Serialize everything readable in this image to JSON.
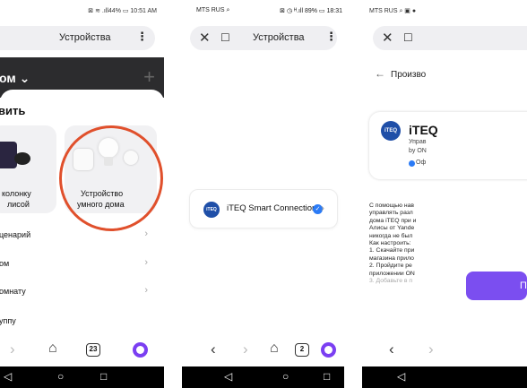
{
  "panel1": {
    "status_right": "⊠ ≋ .ıll44% ▭ 10:51 AM",
    "title": "Устройства",
    "menu": "⋮",
    "home": "ом ⌄",
    "plus": "+",
    "sheet_title": "вить",
    "card_left_line1": "колонку",
    "card_left_line2": "лисой",
    "card_right_line1": "Устройство",
    "card_right_line2": "умного дома",
    "rows": [
      "ценарий",
      "ом",
      "омнату",
      "уппу"
    ],
    "tabs": "23",
    "accent": "#e0502c"
  },
  "panel2": {
    "status_left": "MTS RUS ⌕",
    "status_right": "⊠ ◷ ᴴ.ıll 89% ▭ 18:31",
    "close": "✕",
    "bookmark": "☐",
    "title": "Устройства",
    "menu": "⋮",
    "item_name": "iTEQ Smart Connection",
    "logo_text": "iTEQ",
    "verified": "✓",
    "tabs": "2"
  },
  "panel3": {
    "status_left": "MTS RUS ⌕ ▣ ●",
    "close": "✕",
    "bookmark": "☐",
    "back_label": "Произво",
    "logo_text": "iTEQ",
    "app_name": "iTEQ",
    "app_sub": "Управ",
    "app_by": "by ON",
    "app_badge": "Оф",
    "desc_lines": [
      "С помощью нав",
      "управлять разл",
      "дома iTEQ при и",
      "Алисы от Yande",
      "никогда не был",
      "Как настроить:",
      "1. Скачайте при",
      "магазина прило",
      "2. Пройдите ре",
      "приложении ON",
      "3. Добавьте в п"
    ],
    "button": "Пр"
  },
  "nav_icons": [
    "chevron-left",
    "chevron-right",
    "home",
    "tabs",
    "alice"
  ],
  "android_keys": [
    "◁",
    "○",
    "□"
  ]
}
